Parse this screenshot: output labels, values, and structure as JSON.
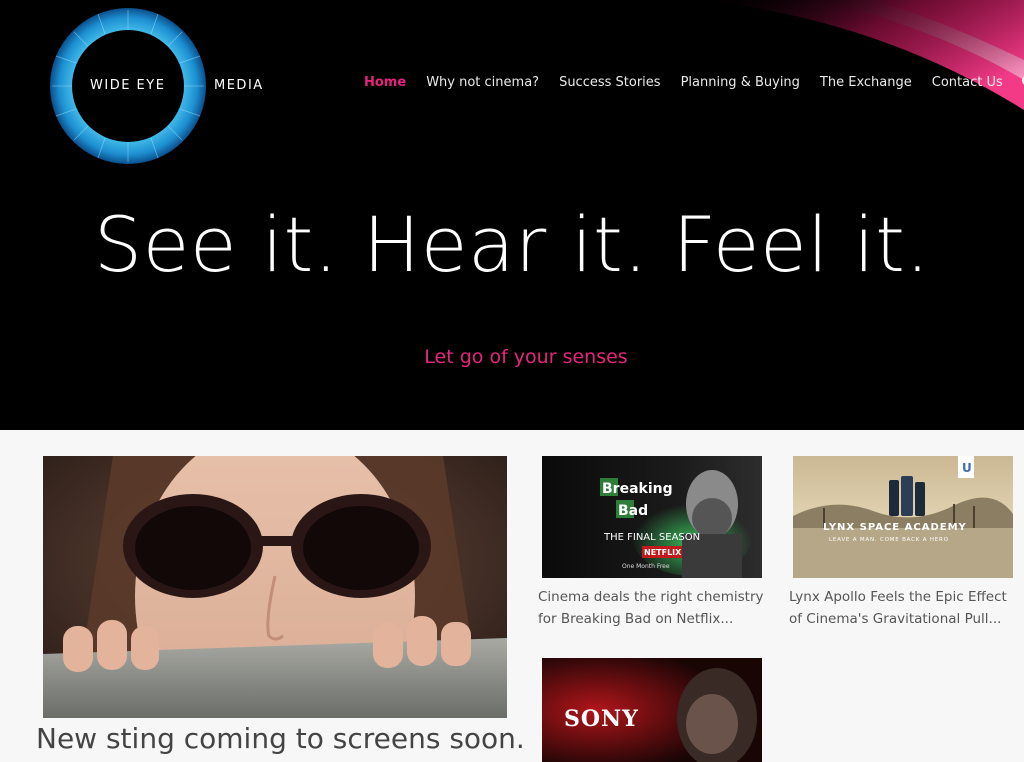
{
  "logo": {
    "text_left": "WIDE EYE",
    "text_right": "MEDIA"
  },
  "nav": {
    "items": [
      {
        "label": "Home",
        "active": true
      },
      {
        "label": "Why not cinema?"
      },
      {
        "label": "Success Stories"
      },
      {
        "label": "Planning & Buying"
      },
      {
        "label": "The Exchange"
      },
      {
        "label": "Contact Us"
      }
    ],
    "search_icon": "search-icon"
  },
  "hero": {
    "headline": "See it. Hear it. Feel it.",
    "tagline": "Let go of your senses"
  },
  "feature": {
    "caption": "New sting coming to screens soon."
  },
  "cards": [
    {
      "image_text": {
        "title_line1": "Breaking",
        "title_line2": "Bad",
        "subtitle": "THE FINAL SEASON",
        "footer": "One Month Free",
        "brand": "NETFLIX"
      },
      "caption_line1": "Cinema deals the right chemistry",
      "caption_line2": "for Breaking Bad on Netflix..."
    },
    {
      "image_text": {
        "title": "LYNX SPACE ACADEMY",
        "subtitle": "LEAVE A MAN. COME BACK A HERO",
        "badge": "U"
      },
      "caption_line1": "Lynx Apollo Feels the Epic Effect",
      "caption_line2": "of Cinema's Gravitational Pull..."
    },
    {
      "image_text": {
        "brand": "SONY"
      }
    }
  ],
  "colors": {
    "accent": "#e6247e",
    "background": "#000000",
    "content_bg": "#f7f7f7"
  }
}
